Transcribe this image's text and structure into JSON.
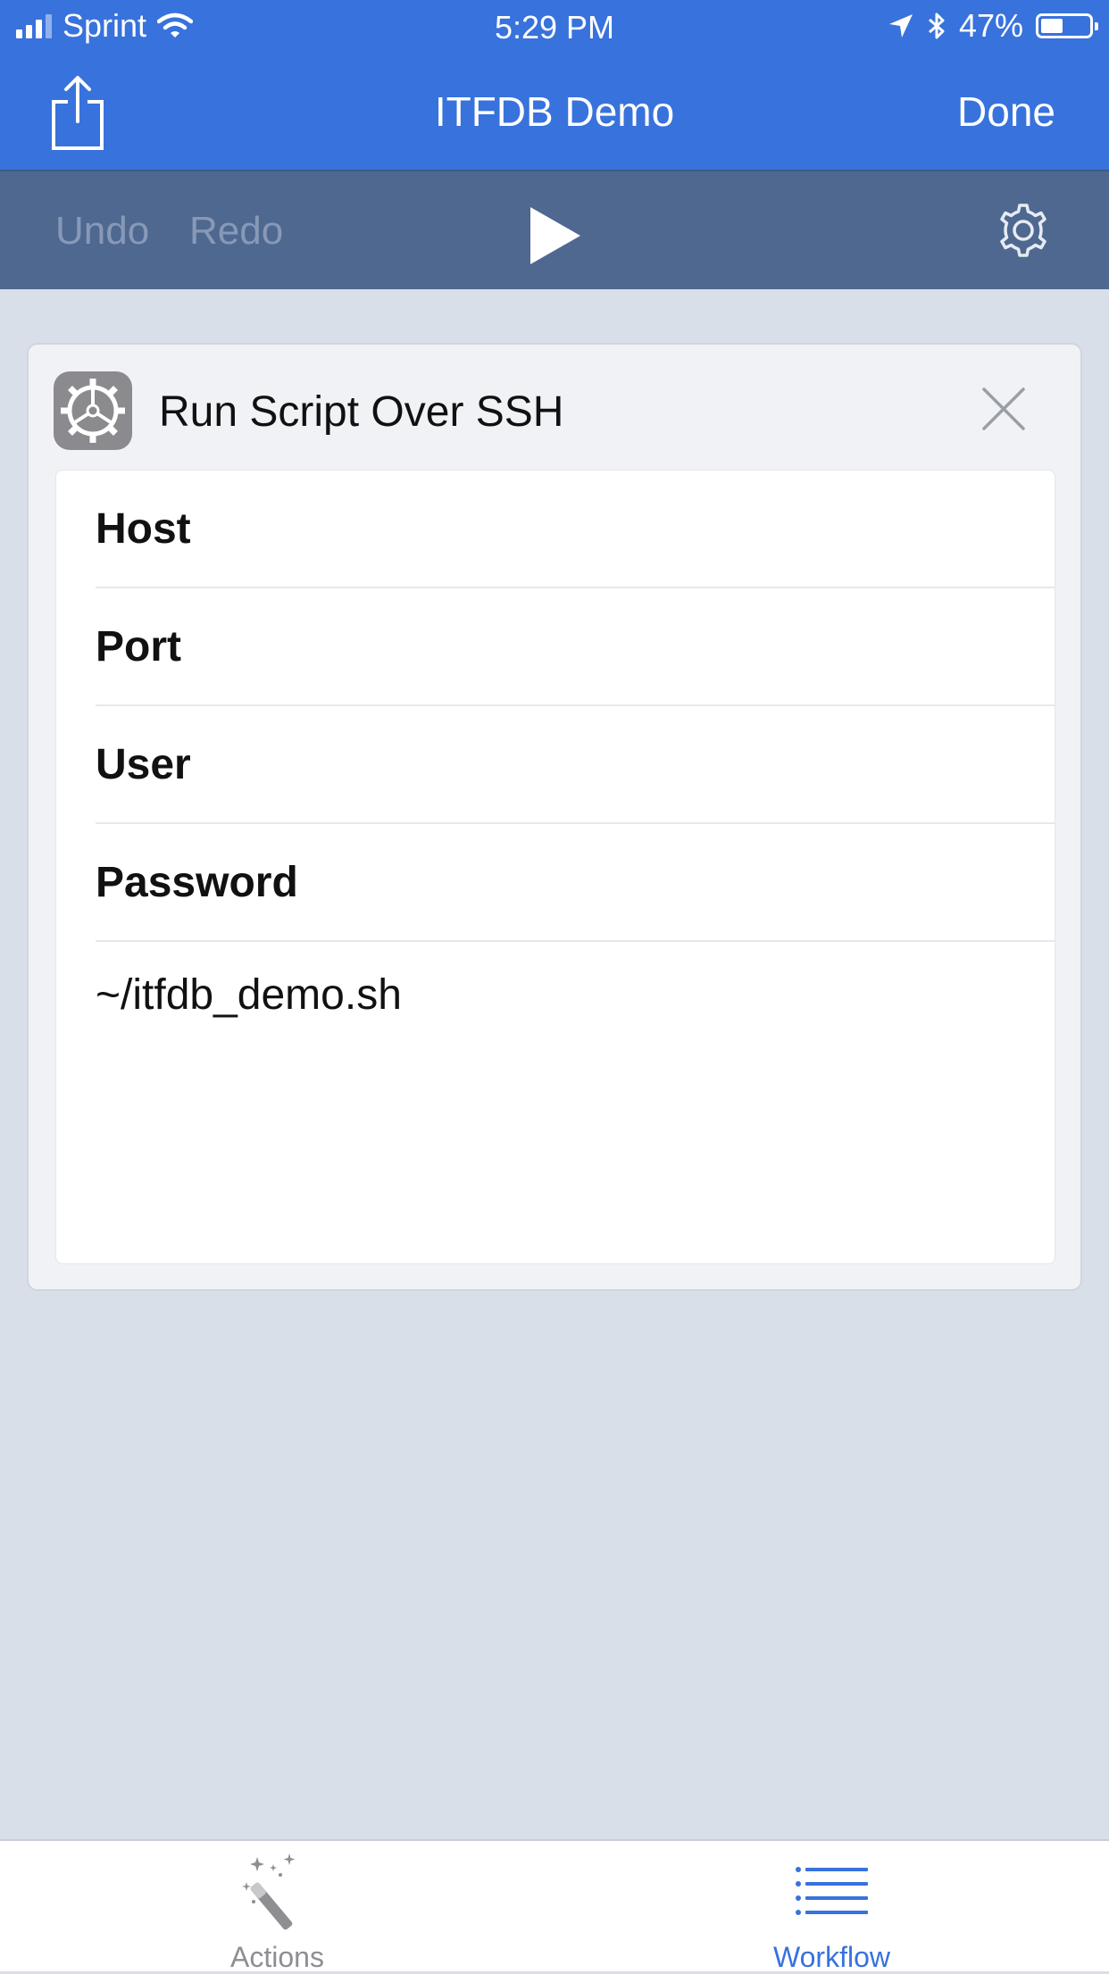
{
  "status_bar": {
    "carrier": "Sprint",
    "time": "5:29 PM",
    "battery_percent_text": "47%",
    "battery_level": 0.47
  },
  "nav": {
    "title": "ITFDB Demo",
    "done_label": "Done"
  },
  "toolbar": {
    "undo_label": "Undo",
    "redo_label": "Redo"
  },
  "action": {
    "title": "Run Script Over SSH",
    "fields": [
      {
        "label": "Host"
      },
      {
        "label": "Port"
      },
      {
        "label": "User"
      },
      {
        "label": "Password"
      }
    ],
    "script": "~/itfdb_demo.sh"
  },
  "tabs": {
    "actions_label": "Actions",
    "workflow_label": "Workflow"
  },
  "colors": {
    "nav_blue": "#3872dc",
    "toolbar": "#4f6890",
    "background": "#d9dfe8",
    "active_tab": "#3872dc",
    "inactive_tab": "#8e8e93"
  }
}
